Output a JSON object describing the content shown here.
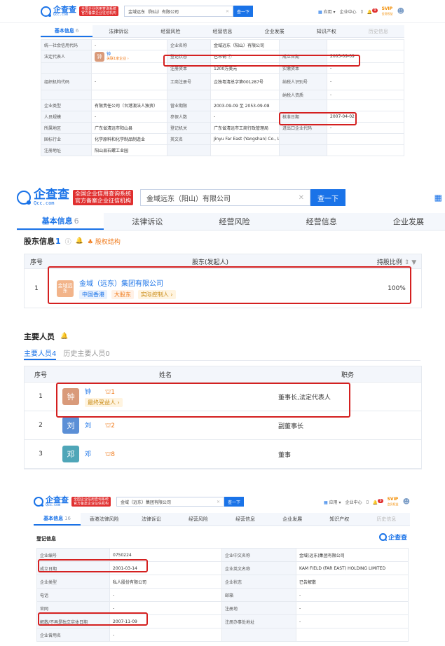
{
  "brand": {
    "logo_text": "企查查",
    "logo_sub": "Qcc.com",
    "badge_line1": "全国企业信用查询系统",
    "badge_line2": "官方备案企业征信机构",
    "search_button": "查一下",
    "clear_icon": "✕",
    "qichacha_label": "企查查"
  },
  "panel1": {
    "search_value": "金域远东（阳山）有限公司",
    "top_right": {
      "app": "应用",
      "company_center": "企业中心",
      "notify_count": "9",
      "vip": "SVIP",
      "vip_sub": "会员权益"
    },
    "tabs": [
      {
        "label": "基本信息",
        "count": "6"
      },
      {
        "label": "法律诉讼",
        "count": ""
      },
      {
        "label": "经营风险",
        "count": ""
      },
      {
        "label": "经营信息",
        "count": ""
      },
      {
        "label": "企业发展",
        "count": ""
      },
      {
        "label": "知识产权",
        "count": ""
      },
      {
        "label": "历史信息",
        "count": ""
      }
    ],
    "rows": [
      [
        "统一社会信用代码",
        "-",
        "企业名称",
        "金域远东（阳山）有限公司",
        "",
        ""
      ],
      [
        "法定代表人",
        "",
        "登记状态",
        "已吊销 ⓘ",
        "成立日期",
        "2003-09-09"
      ],
      [
        "",
        "",
        "注册资本",
        "1200万美元",
        "实缴资本",
        "-"
      ],
      [
        "组织机构代码",
        "-",
        "工商注册号",
        "企独粤清总字第001287号",
        "纳税人识别号",
        "-"
      ],
      [
        "",
        "",
        "",
        "",
        "纳税人资质",
        "-"
      ],
      [
        "企业类型",
        "有限责任公司（台港澳法人独资）",
        "营业期限",
        "2003-09-09 至 2053-09-08",
        "",
        ""
      ],
      [
        "人员规模",
        "-",
        "参保人数",
        "-",
        "核准日期",
        "2007-04-02"
      ],
      [
        "所属地区",
        "广东省清远市阳山县",
        "登记机关",
        "广东省清远市工商行政管理局",
        "进出口企业代码",
        "-"
      ],
      [
        "国标行业",
        "化学原料和化学制品制造业",
        "英文名",
        "Jinyu Far East (Yangshan) Co., Ltd.",
        "",
        ""
      ],
      [
        "注册地址",
        "阳山县石螺工业园",
        "",
        "",
        "",
        ""
      ]
    ],
    "legal_rep": {
      "avatar": "钟",
      "name": "钟",
      "link": "关联1家企业 ›"
    },
    "english_note": "（自动翻译）",
    "addr_link": "附近企业"
  },
  "panel2": {
    "search_value": "金域远东（阳山）有限公司",
    "tabs": [
      {
        "label": "基本信息",
        "count": "6"
      },
      {
        "label": "法律诉讼",
        "count": ""
      },
      {
        "label": "经营风险",
        "count": ""
      },
      {
        "label": "经营信息",
        "count": ""
      },
      {
        "label": "企业发展",
        "count": ""
      }
    ],
    "shareholder_title": "股东信息",
    "shareholder_count": "1",
    "equity_link": "股权结构",
    "sh_headers": [
      "序号",
      "股东(发起人)",
      "持股比例"
    ],
    "shareholders": [
      {
        "no": "1",
        "avatar": "金域远东",
        "name": "金域（远东）集团有限公司",
        "tags": [
          "中国香港",
          "大股东",
          "实际控制人 ›"
        ],
        "ratio": "100%"
      }
    ],
    "key_title": "主要人员",
    "key_tab_active": "主要人员",
    "key_tab_active_count": "4",
    "key_tab_hist": "历史主要人员",
    "key_tab_hist_count": "0",
    "kp_headers": [
      "序号",
      "姓名",
      "职务"
    ],
    "key_persons": [
      {
        "no": "1",
        "avatar": "钟",
        "name": "钟",
        "count": "1",
        "tag": "最终受益人 ›",
        "role": "董事长,法定代表人",
        "color": "#d99a7a"
      },
      {
        "no": "2",
        "avatar": "刘",
        "name": "刘",
        "count": "2",
        "tag": "",
        "role": "副董事长",
        "color": "#5b8fd6"
      },
      {
        "no": "3",
        "avatar": "邓",
        "name": "邓",
        "count": "8",
        "tag": "",
        "role": "董事",
        "color": "#4fa6b8"
      }
    ]
  },
  "panel3": {
    "search_value": "金域（远东）集团有限公司",
    "tabs": [
      {
        "label": "基本信息",
        "count": "16"
      },
      {
        "label": "香港法律风险",
        "count": ""
      },
      {
        "label": "法律诉讼",
        "count": ""
      },
      {
        "label": "经营风险",
        "count": ""
      },
      {
        "label": "经营信息",
        "count": ""
      },
      {
        "label": "企业发展",
        "count": ""
      },
      {
        "label": "知识产权",
        "count": ""
      },
      {
        "label": "历史信息",
        "count": ""
      }
    ],
    "section_title": "登记信息",
    "rows": [
      [
        "企业编号",
        "0750224",
        "企业中文名称",
        "金域(远东)集团有限公司"
      ],
      [
        "成立日期",
        "2001-03-14",
        "企业英文名称",
        "KAM FIELD (FAR EAST) HOLDING LIMITED"
      ],
      [
        "企业类型",
        "私人股份有限公司",
        "企业状态",
        "已告解散"
      ],
      [
        "电话",
        "-",
        "邮箱",
        "-"
      ],
      [
        "官网",
        "-",
        "注册地",
        "-"
      ],
      [
        "解散/不再是独立实体日期",
        "2007-11-09",
        "注册办事处地址",
        "-"
      ],
      [
        "企业曾用名",
        "-",
        "",
        ""
      ]
    ]
  }
}
